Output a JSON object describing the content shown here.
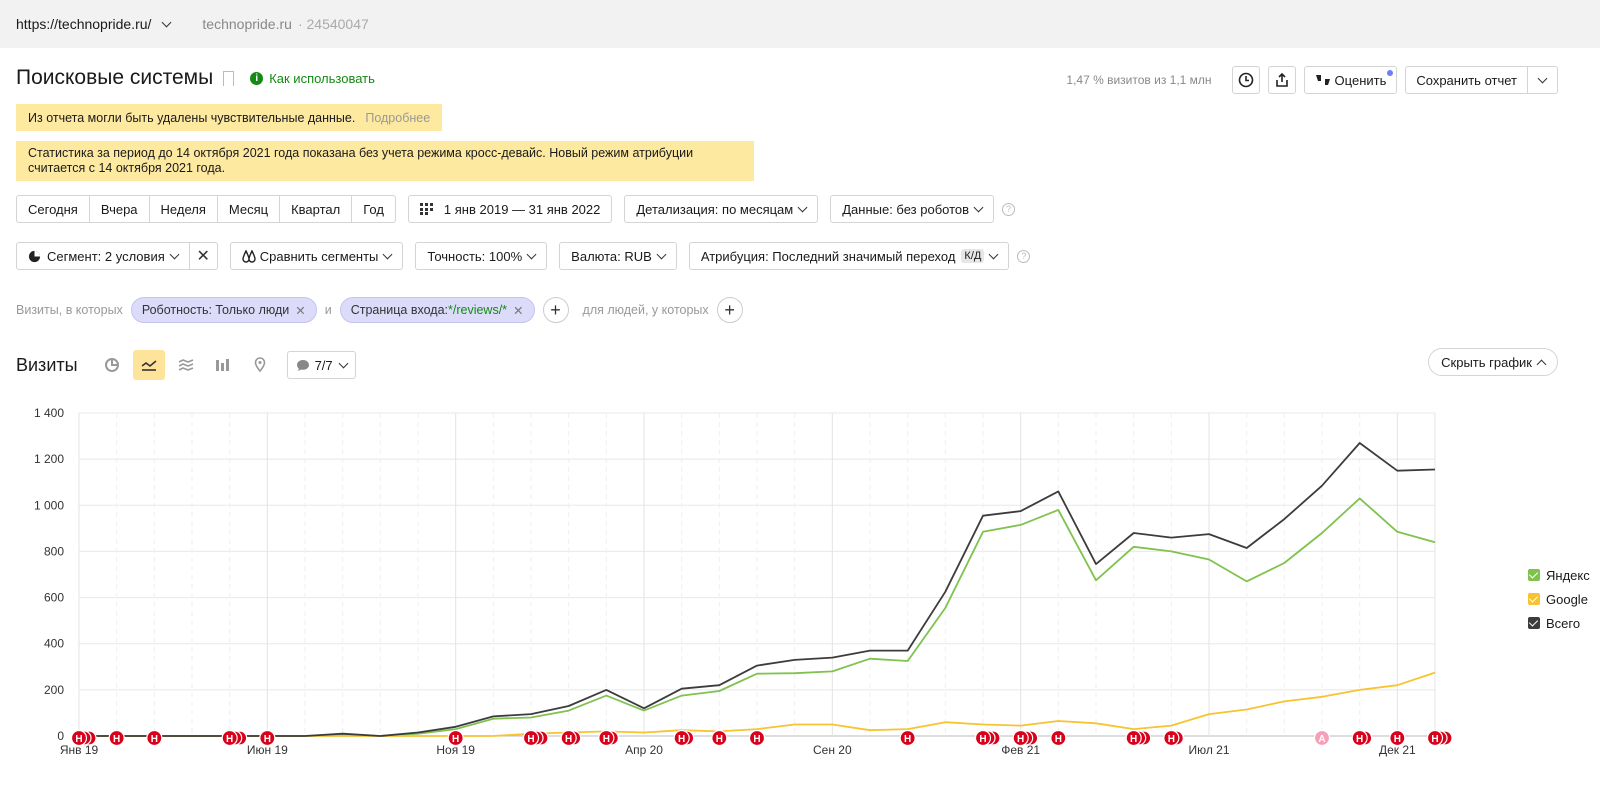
{
  "topbar": {
    "url": "https://technopride.ru/",
    "site": "technopride.ru",
    "counter_id": "24540047"
  },
  "header": {
    "title": "Поисковые системы",
    "how_to": "Как использовать",
    "visits_share": "1,47 % визитов из 1,1 млн",
    "rate_label": "Оценить",
    "save_label": "Сохранить отчет"
  },
  "notices": {
    "sensitive": "Из отчета могли быть удалены чувствительные данные.",
    "sensitive_more": "Подробнее",
    "crossdevice_line1": "Статистика за период до 14 октября 2021 года показана без учета режима кросс-девайс. Новый режим атрибуции",
    "crossdevice_line2": "считается с 14 октября 2021 года."
  },
  "period": {
    "presets": [
      "Сегодня",
      "Вчера",
      "Неделя",
      "Месяц",
      "Квартал",
      "Год"
    ],
    "date_range": "1 янв 2019 — 31 янв 2022",
    "detail": "Детализация: по месяцам",
    "data": "Данные: без роботов"
  },
  "filters": {
    "segment": "Сегмент: 2 условия",
    "compare": "Сравнить сегменты",
    "accuracy": "Точность: 100%",
    "currency": "Валюта: RUB",
    "attribution": "Атрибуция: Последний значимый переход",
    "attribution_badge": "К/Д"
  },
  "conditions": {
    "prefix": "Визиты, в которых",
    "chip1": "Роботность: Только люди",
    "and": "и",
    "chip2_label": "Страница входа: ",
    "chip2_value": "*/reviews/*",
    "people_label": "для людей, у которых"
  },
  "visits": {
    "title": "Визиты",
    "count": "7/7",
    "hide_graph": "Скрыть график"
  },
  "colors": {
    "yandex": "#7fc24e",
    "google": "#f7c330",
    "total": "#3c3c3c",
    "marker": "#d8001b",
    "marker_a": "#f4a0b8"
  },
  "chart_data": {
    "type": "line",
    "x": [
      "2019-01",
      "2019-02",
      "2019-03",
      "2019-04",
      "2019-05",
      "2019-06",
      "2019-07",
      "2019-08",
      "2019-09",
      "2019-10",
      "2019-11",
      "2019-12",
      "2020-01",
      "2020-02",
      "2020-03",
      "2020-04",
      "2020-05",
      "2020-06",
      "2020-07",
      "2020-08",
      "2020-09",
      "2020-10",
      "2020-11",
      "2020-12",
      "2021-01",
      "2021-02",
      "2021-03",
      "2021-04",
      "2021-05",
      "2021-06",
      "2021-07",
      "2021-08",
      "2021-09",
      "2021-10",
      "2021-11",
      "2021-12",
      "2022-01"
    ],
    "x_tick_labels": [
      "Янв 19",
      "Июн 19",
      "Ноя 19",
      "Апр 20",
      "Сен 20",
      "Фев 21",
      "Июл 21",
      "Дек 21"
    ],
    "x_tick_index": [
      0,
      5,
      10,
      15,
      20,
      25,
      30,
      35
    ],
    "y_ticks": [
      "0",
      "200",
      "400",
      "600",
      "800",
      "1 000",
      "1 200",
      "1 400"
    ],
    "ylim": [
      0,
      1400
    ],
    "grid": true,
    "legend": "right",
    "series": [
      {
        "name": "Яндекс",
        "values": [
          0,
          0,
          0,
          0,
          0,
          0,
          0,
          5,
          0,
          10,
          30,
          75,
          80,
          110,
          175,
          110,
          175,
          195,
          270,
          272,
          280,
          335,
          325,
          555,
          885,
          915,
          980,
          675,
          820,
          800,
          765,
          670,
          750,
          880,
          1030,
          885,
          840
        ]
      },
      {
        "name": "Google",
        "values": [
          0,
          0,
          0,
          0,
          0,
          0,
          0,
          0,
          0,
          0,
          0,
          0,
          10,
          15,
          20,
          15,
          25,
          20,
          30,
          50,
          50,
          25,
          30,
          60,
          50,
          45,
          65,
          55,
          30,
          45,
          95,
          115,
          150,
          170,
          200,
          220,
          275
        ]
      },
      {
        "name": "Всего",
        "values": [
          0,
          0,
          0,
          0,
          0,
          0,
          0,
          10,
          0,
          15,
          40,
          85,
          95,
          130,
          200,
          120,
          205,
          220,
          305,
          330,
          340,
          370,
          370,
          625,
          955,
          975,
          1060,
          745,
          880,
          860,
          875,
          815,
          940,
          1085,
          1270,
          1150,
          1155
        ]
      }
    ],
    "markers": [
      {
        "index": 0,
        "label": "Н",
        "count": 3
      },
      {
        "index": 1,
        "label": "Н",
        "count": 1
      },
      {
        "index": 2,
        "label": "Н",
        "count": 1
      },
      {
        "index": 4,
        "label": "Н",
        "count": 3
      },
      {
        "index": 5,
        "label": "Н",
        "count": 1
      },
      {
        "index": 10,
        "label": "Н",
        "count": 1
      },
      {
        "index": 12,
        "label": "Н",
        "count": 3
      },
      {
        "index": 13,
        "label": "Н",
        "count": 2
      },
      {
        "index": 14,
        "label": "Н",
        "count": 2
      },
      {
        "index": 16,
        "label": "Н",
        "count": 2
      },
      {
        "index": 17,
        "label": "Н",
        "count": 1
      },
      {
        "index": 18,
        "label": "Н",
        "count": 1
      },
      {
        "index": 22,
        "label": "Н",
        "count": 1
      },
      {
        "index": 24,
        "label": "Н",
        "count": 3
      },
      {
        "index": 25,
        "label": "Н",
        "count": 3
      },
      {
        "index": 26,
        "label": "Н",
        "count": 1
      },
      {
        "index": 28,
        "label": "Н",
        "count": 3
      },
      {
        "index": 29,
        "label": "Н",
        "count": 2
      },
      {
        "index": 33,
        "label": "А",
        "count": 1
      },
      {
        "index": 34,
        "label": "Н",
        "count": 2
      },
      {
        "index": 35,
        "label": "Н",
        "count": 1
      },
      {
        "index": 36,
        "label": "Н",
        "count": 3
      }
    ]
  }
}
